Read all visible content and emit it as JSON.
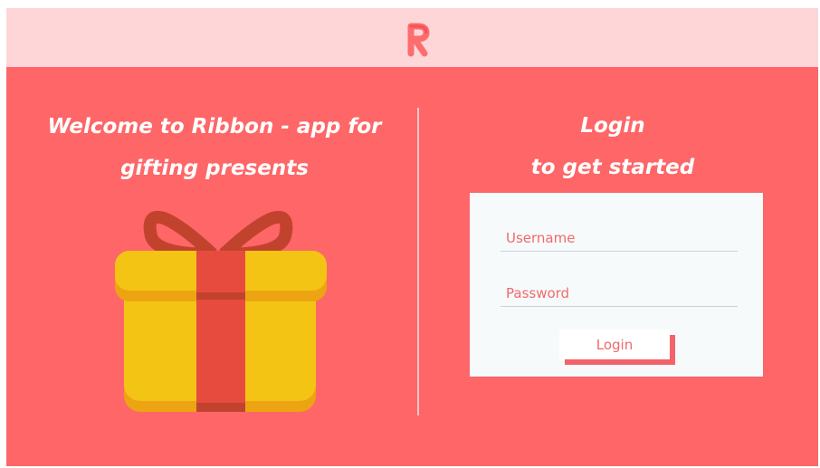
{
  "header": {
    "logo_letter": "R",
    "logo_icon": "ribbon-r-logo-icon"
  },
  "left_panel": {
    "welcome_line1": "Welcome to Ribbon - app for",
    "welcome_line2": "gifting presents",
    "illustration_icon": "gift-box-icon"
  },
  "right_panel": {
    "heading_line1": "Login",
    "heading_line2": "to get started"
  },
  "login_form": {
    "username_placeholder": "Username",
    "password_placeholder": "Password",
    "login_button_label": "Login"
  },
  "colors": {
    "background": "#fe6668",
    "header": "#fed6d8",
    "gift_yellow": "#f3c414",
    "ribbon_red": "#e74b3d",
    "card": "#f6fafb",
    "accent_text": "#f06a6d"
  }
}
